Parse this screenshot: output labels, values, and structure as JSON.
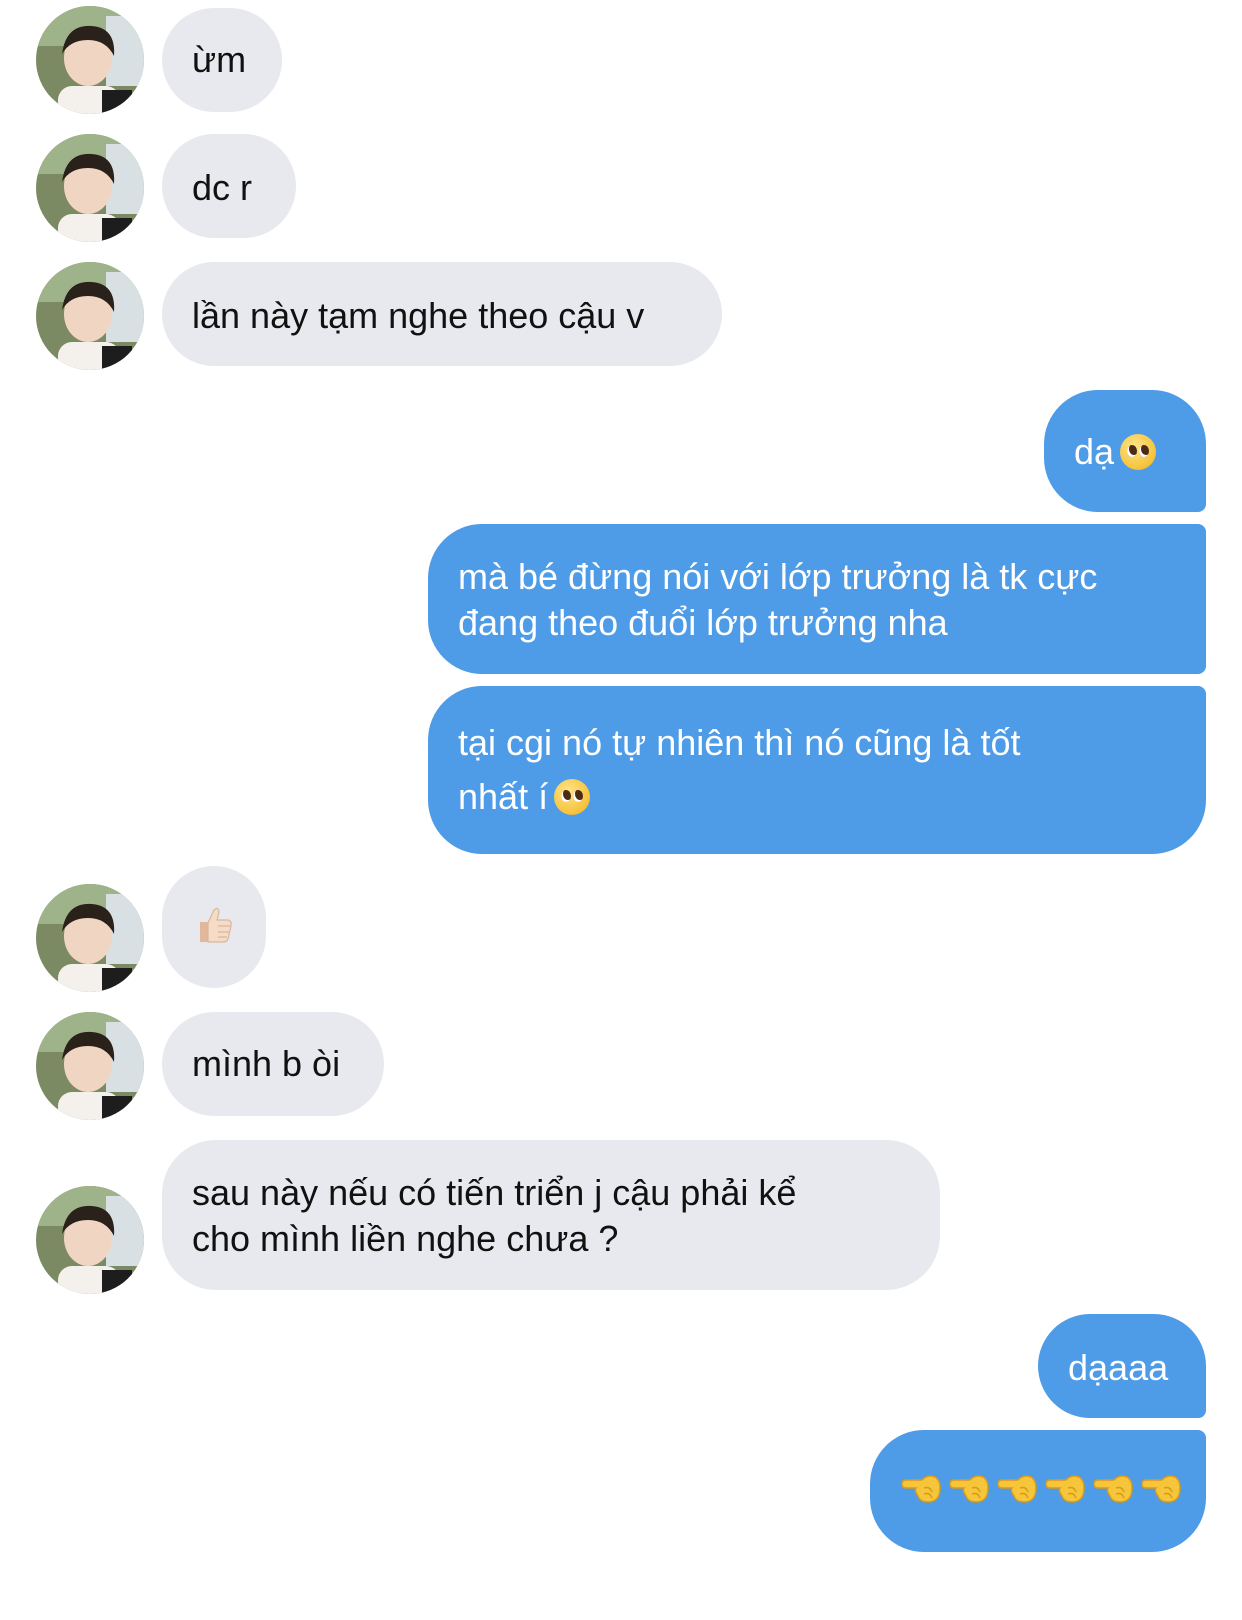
{
  "conversation": {
    "messages": [
      {
        "sender": "them",
        "text": "ừm"
      },
      {
        "sender": "them",
        "text": "dc r"
      },
      {
        "sender": "them",
        "text": "lần này tạm nghe theo cậu v"
      },
      {
        "sender": "me",
        "text": "dạ",
        "emoji": "pleading-face-emoji"
      },
      {
        "sender": "me",
        "line1": "mà bé đừng nói với lớp trưởng là tk cực",
        "line2": "đang theo đuổi lớp trưởng nha"
      },
      {
        "sender": "me",
        "line1": "tại cgi nó tự nhiên thì nó cũng là tốt",
        "line2": "nhất í",
        "emoji": "pleading-face-emoji"
      },
      {
        "sender": "them",
        "emoji": "thumbs-up-emoji"
      },
      {
        "sender": "them",
        "text": "mình b òi"
      },
      {
        "sender": "them",
        "line1": "sau này nếu có tiến triển j cậu phải kể",
        "line2": "cho mình liền nghe chưa ?"
      },
      {
        "sender": "me",
        "text": "dạaaa"
      },
      {
        "sender": "me",
        "emoji": "pointing-left-hand-emoji",
        "emoji_count": 6
      }
    ]
  },
  "colors": {
    "incoming_bubble": "#e8e9ee",
    "outgoing_bubble": "#4e9ce8",
    "incoming_text": "#111111",
    "outgoing_text": "#ffffff"
  }
}
